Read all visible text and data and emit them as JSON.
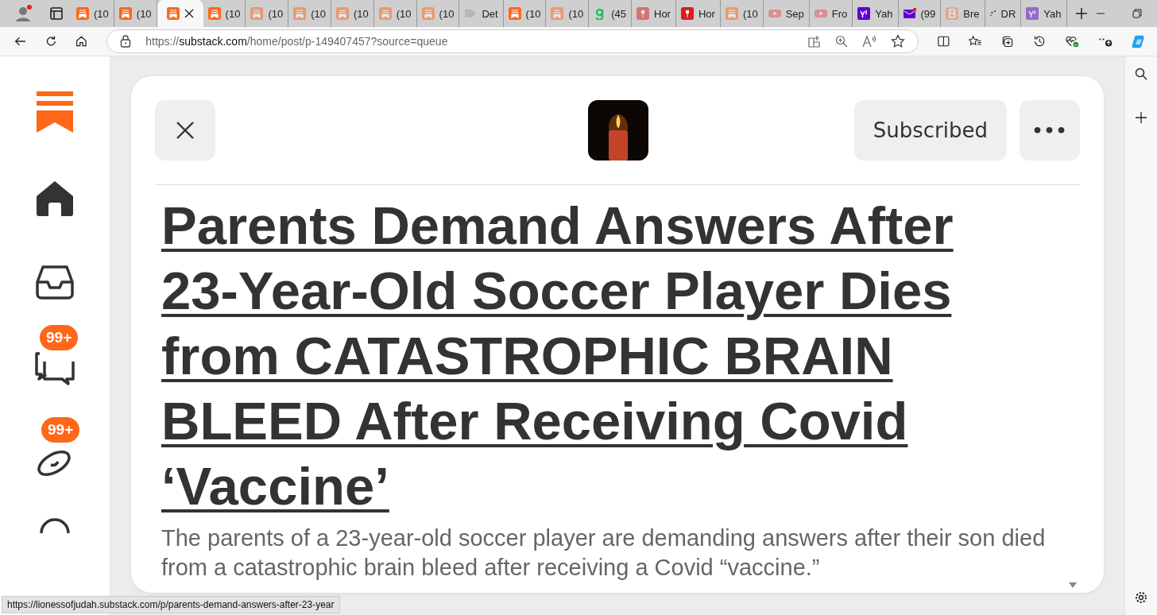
{
  "tabs": [
    {
      "kind": "substack",
      "title": "(10",
      "selected": false,
      "sleeping": false
    },
    {
      "kind": "substack",
      "title": "(10",
      "selected": false,
      "sleeping": false
    },
    {
      "kind": "substack",
      "selected": true,
      "sleeping": false
    },
    {
      "kind": "substack",
      "title": "(10",
      "selected": false,
      "sleeping": false
    },
    {
      "kind": "substack",
      "title": "(10",
      "selected": false,
      "sleeping": true
    },
    {
      "kind": "substack",
      "title": "(10",
      "selected": false,
      "sleeping": true
    },
    {
      "kind": "substack",
      "title": "(10",
      "selected": false,
      "sleeping": true
    },
    {
      "kind": "substack",
      "title": "(10",
      "selected": false,
      "sleeping": true
    },
    {
      "kind": "substack",
      "title": "(10",
      "selected": false,
      "sleeping": true
    },
    {
      "kind": "arrow",
      "title": "Det",
      "selected": false,
      "sleeping": true
    },
    {
      "kind": "substack",
      "title": "(10",
      "selected": false,
      "sleeping": false
    },
    {
      "kind": "substack",
      "title": "(10",
      "selected": false,
      "sleeping": true
    },
    {
      "kind": "letter-g",
      "title": "(45",
      "selected": false,
      "sleeping": false
    },
    {
      "kind": "torch",
      "title": "Hor",
      "selected": false,
      "sleeping": true
    },
    {
      "kind": "torch",
      "title": "Hor",
      "selected": false,
      "sleeping": false
    },
    {
      "kind": "substack",
      "title": "(10",
      "selected": false,
      "sleeping": true
    },
    {
      "kind": "video",
      "title": "Sep",
      "selected": false,
      "sleeping": true
    },
    {
      "kind": "video",
      "title": "Fro",
      "selected": false,
      "sleeping": true
    },
    {
      "kind": "yahoo",
      "title": "Yah",
      "selected": false,
      "sleeping": false
    },
    {
      "kind": "mail",
      "title": "(99",
      "selected": false,
      "sleeping": false
    },
    {
      "kind": "letter-b",
      "title": "Bre",
      "selected": false,
      "sleeping": true
    },
    {
      "kind": "spinner",
      "title": "DR",
      "selected": false,
      "sleeping": false
    },
    {
      "kind": "yahoo",
      "title": "Yah",
      "selected": false,
      "sleeping": true
    }
  ],
  "address_bar": {
    "scheme": "https://",
    "domain": "substack.com",
    "path": "/home/post/p-149407457?source=queue"
  },
  "sidebar": {
    "badges": [
      {
        "count": "99+"
      },
      {
        "count": "99+"
      }
    ]
  },
  "post": {
    "subscribe_button": "Subscribed",
    "more_button": "•••",
    "title": "Parents Demand Answers After 23-Year-Old Soccer Player Dies from CATASTROPHIC BRAIN BLEED After Receiving Covid ‘Vaccine’",
    "subtitle": "The parents of a 23-year-old soccer player are demanding answers after their son died from a catastrophic brain bleed after receiving a Covid “vaccine.”"
  },
  "status_bar": {
    "link": "https://lionessofjudah.substack.com/p/parents-demand-answers-after-23-year"
  }
}
